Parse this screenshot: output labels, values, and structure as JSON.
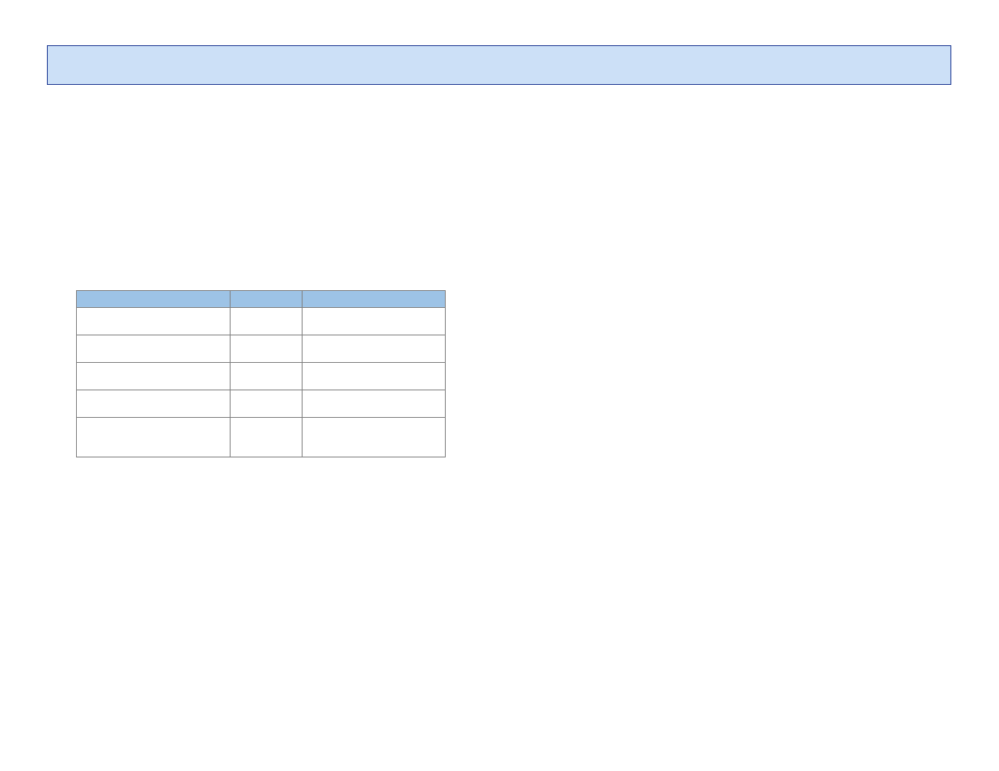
{
  "header": {
    "text": ""
  },
  "table": {
    "headers": [
      "",
      "",
      ""
    ],
    "rows": [
      [
        "",
        "",
        ""
      ],
      [
        "",
        "",
        ""
      ],
      [
        "",
        "",
        ""
      ],
      [
        "",
        "",
        ""
      ],
      [
        "",
        "",
        ""
      ]
    ]
  }
}
